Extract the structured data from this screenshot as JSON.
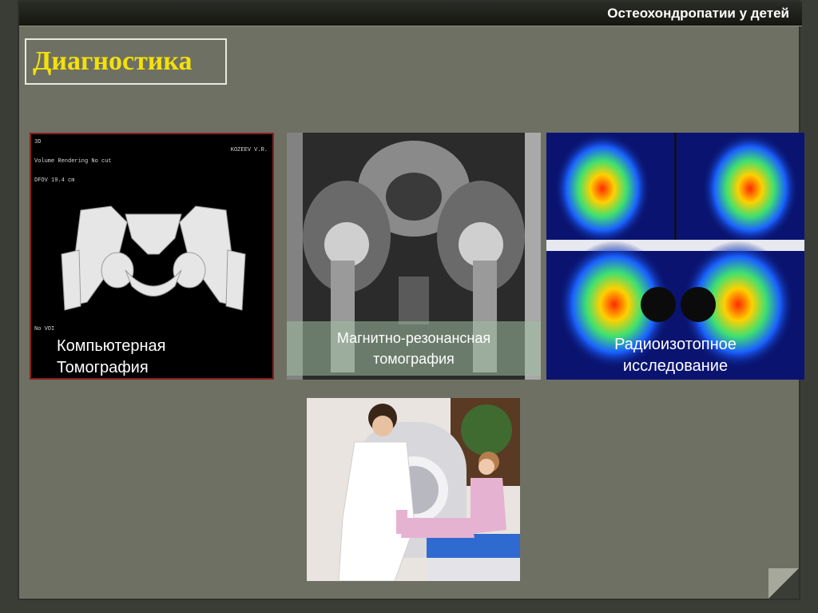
{
  "header": {
    "title": "Остеохондропатии у детей"
  },
  "section": {
    "title": "Диагностика"
  },
  "panels": {
    "ct": {
      "caption_line1": "Компьютерная",
      "caption_line2": "Томография",
      "meta": [
        "3D",
        "Volume Rendering  No cut",
        "DFOV 19.4 cm",
        "No VOI",
        "KOZEEV V.R."
      ]
    },
    "mri": {
      "caption_line1": "Магнитно-резонансная",
      "caption_line2": "томография"
    },
    "nuclear": {
      "caption_line1": "Радиоизотопное",
      "caption_line2": "исследование"
    }
  },
  "colors": {
    "title_yellow": "#f4e00b",
    "slide_bg": "#6e7063",
    "ct_border": "#8b1f20"
  },
  "icons": {
    "ct_image": "pelvis-3d-render",
    "mri_image": "pelvis-mri",
    "nuclear_image": "scintigraphy-scan",
    "photo": "child-ct-exam-photo"
  }
}
